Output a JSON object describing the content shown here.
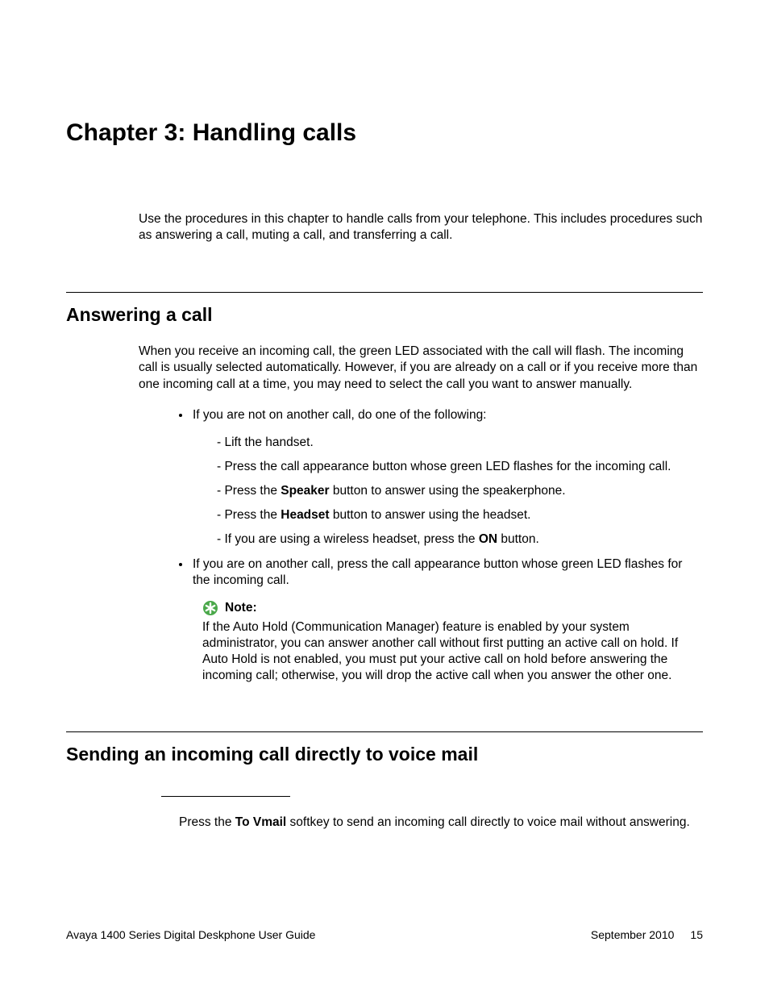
{
  "chapter": {
    "title": "Chapter 3:  Handling calls",
    "intro": "Use the procedures in this chapter to handle calls from your telephone. This includes procedures such as answering a call, muting a call, and transferring a call."
  },
  "section1": {
    "heading": "Answering a call",
    "para1": "When you receive an incoming call, the green LED associated with the call will flash. The incoming call is usually selected automatically. However, if you are already on a call or if you receive more than one incoming call at a time, you may need to select the call you want to answer manually.",
    "bullets": {
      "b1_lead": "If you are not on another call, do one of the following:",
      "b1_dashes": {
        "d1": "- Lift the handset.",
        "d2": "- Press the call appearance button whose green LED flashes for the incoming call.",
        "d3_pre": "- Press the ",
        "d3_bold": "Speaker",
        "d3_post": " button to answer using the speakerphone.",
        "d4_pre": "- Press the ",
        "d4_bold": "Headset",
        "d4_post": " button to answer using the headset.",
        "d5_pre": "- If you are using a wireless headset, press the ",
        "d5_bold": "ON",
        "d5_post": " button."
      },
      "b2": "If you are on another call, press the call appearance button whose green LED flashes for the incoming call."
    },
    "note": {
      "label": "Note:",
      "body": "If the Auto Hold (Communication Manager) feature is enabled by your system administrator, you can answer another call without first putting an active call on hold. If Auto Hold is not enabled, you must put your active call on hold before answering the incoming call; otherwise, you will drop the active call when you answer the other one."
    }
  },
  "section2": {
    "heading": "Sending an incoming call directly to voice mail",
    "body_pre": "Press the ",
    "body_bold": "To Vmail",
    "body_post": " softkey to send an incoming call directly to voice mail without answering."
  },
  "footer": {
    "left": "Avaya 1400 Series Digital Deskphone User Guide",
    "date": "September 2010",
    "page": "15"
  }
}
